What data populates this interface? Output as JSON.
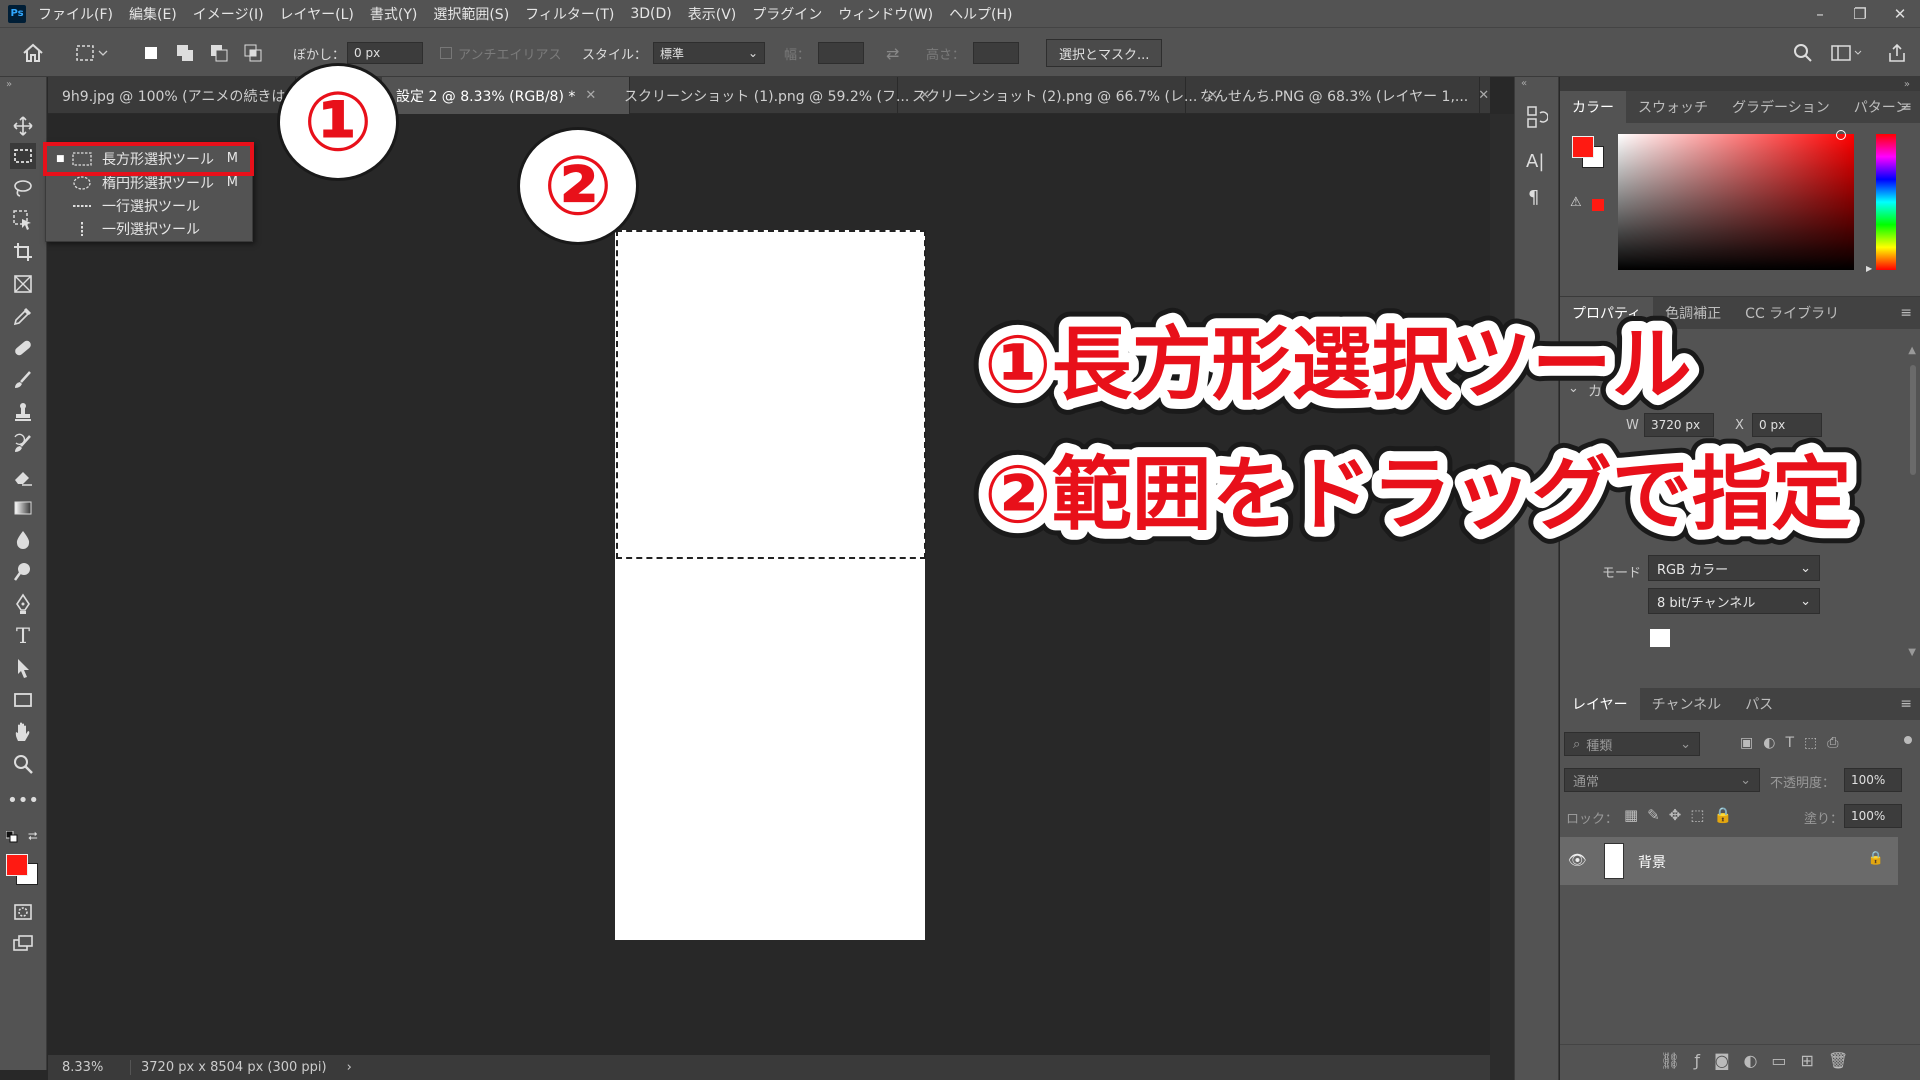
{
  "app": {
    "logo": "Ps"
  },
  "menubar": {
    "items": [
      "ファイル(F)",
      "編集(E)",
      "イメージ(I)",
      "レイヤー(L)",
      "書式(Y)",
      "選択範囲(S)",
      "フィルター(T)",
      "3D(D)",
      "表示(V)",
      "プラグイン",
      "ウィンドウ(W)",
      "ヘルプ(H)"
    ]
  },
  "window_controls": [
    "–",
    "❐",
    "✕"
  ],
  "options": {
    "feather_label": "ぼかし：",
    "feather_value": "0 px",
    "antialias_label": "アンチエイリアス",
    "style_label": "スタイル：",
    "style_value": "標準",
    "width_label": "幅：",
    "height_label": "高さ：",
    "select_mask_label": "選択とマスク..."
  },
  "tabs": [
    {
      "label": "9h9.jpg @ 100% (アニメの続きは何..."
    },
    {
      "label": "設定 2 @ 8.33% (RGB/8) *"
    },
    {
      "label": "スクリーンショット (1).png @ 59.2% (フ..."
    },
    {
      "label": "スクリーンショット (2).png @ 66.7% (レ..."
    },
    {
      "label": "なんせんち.PNG @ 68.3% (レイヤー 1,..."
    }
  ],
  "flyout": [
    {
      "label": "長方形選択ツール",
      "key": "M"
    },
    {
      "label": "楕円形選択ツール",
      "key": "M"
    },
    {
      "label": "一行選択ツール",
      "key": ""
    },
    {
      "label": "一列選択ツール",
      "key": ""
    }
  ],
  "status": {
    "zoom": "8.33%",
    "doc_info": "3720 px x 8504 px (300 ppi)",
    "arrow": "›"
  },
  "color_panel": {
    "tabs": [
      "カラー",
      "スウォッチ",
      "グラデーション",
      "パターン"
    ],
    "fg": "#ff1a12",
    "bg": "#ffffff"
  },
  "properties_panel": {
    "tabs": [
      "プロパティ",
      "色調補正",
      "CC ライブラリ"
    ],
    "section": "カン",
    "w_label": "W",
    "w_value": "3720 px",
    "x_label": "X",
    "x_value": "0 px",
    "mode_label": "モード",
    "mode_value": "RGB カラー",
    "depth_value": "8 bit/チャンネル"
  },
  "layers_panel": {
    "tabs": [
      "レイヤー",
      "チャンネル",
      "パス"
    ],
    "filter_placeholder": "種類",
    "blend_mode": "通常",
    "opacity_label": "不透明度：",
    "opacity_value": "100%",
    "lock_label": "ロック：",
    "fill_label": "塗り：",
    "fill_value": "100%",
    "layer_name": "背景"
  },
  "annotations": {
    "circle1": "①",
    "circle2": "②",
    "line1": "①長方形選択ツール",
    "line2": "②範囲をドラッグで指定"
  }
}
